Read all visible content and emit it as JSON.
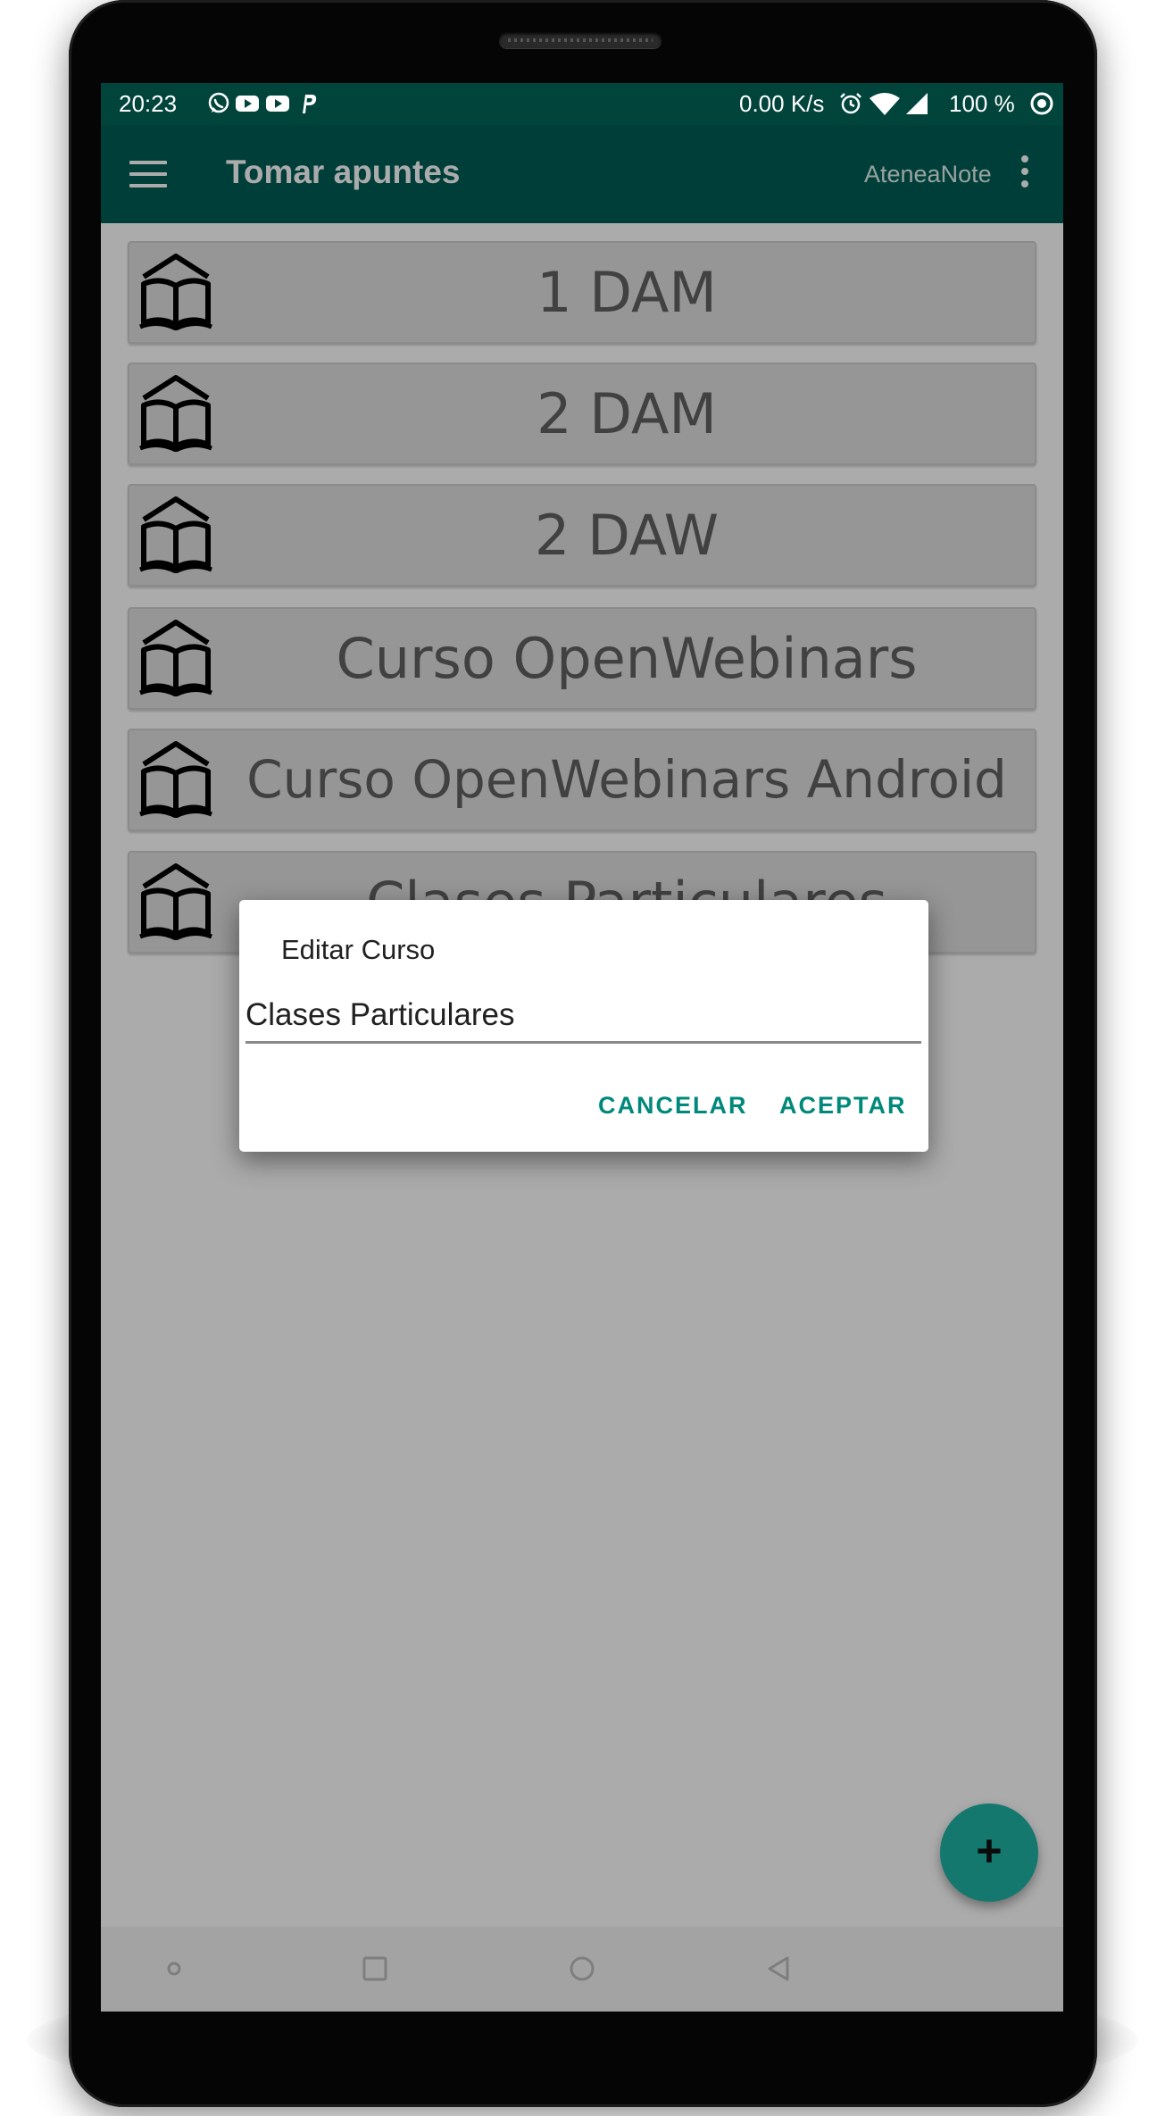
{
  "status_bar": {
    "time": "20:23",
    "left_icons": [
      "whatsapp-icon",
      "youtube-icon",
      "youtube-icon",
      "paypal-icon"
    ],
    "speed": "0.00 K/s",
    "right_icons": [
      "alarm-icon",
      "wifi-icon",
      "signal-icon"
    ],
    "battery": "100 %",
    "last_icon": "sync-circle-icon"
  },
  "app_bar": {
    "title": "Tomar apuntes",
    "app_name": "AteneaNote"
  },
  "courses": [
    {
      "label": "1 DAM"
    },
    {
      "label": "2 DAM"
    },
    {
      "label": "2 DAW"
    },
    {
      "label": "Curso OpenWebinars"
    },
    {
      "label": "Curso OpenWebinars Android"
    },
    {
      "label": "Clases Particulares"
    }
  ],
  "dialog": {
    "title": "Editar Curso",
    "input_value": "Clases Particulares",
    "cancel_label": "CANCELAR",
    "accept_label": "ACEPTAR"
  },
  "fab": {
    "label": "+"
  },
  "colors": {
    "status_bar": "#00443c",
    "app_bar": "#005e55",
    "accent": "#00897b",
    "fab": "#1eb3a6"
  }
}
